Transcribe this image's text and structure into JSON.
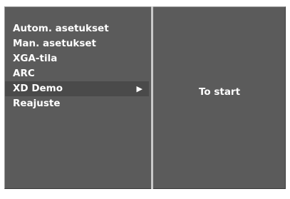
{
  "menu": {
    "items": [
      {
        "label": "Autom. asetukset"
      },
      {
        "label": "Man. asetukset"
      },
      {
        "label": "XGA-tila"
      },
      {
        "label": "ARC"
      },
      {
        "label": "XD Demo",
        "arrow": "▶"
      },
      {
        "label": "Reajuste"
      }
    ],
    "selected_index": 4
  },
  "submenu": {
    "text": "To start"
  },
  "colors": {
    "panel": "#5b5b5b",
    "selected_row": "#4a4a4a",
    "divider": "#c9c9c9",
    "text": "#ffffff"
  },
  "icons": {
    "submenu_arrow": "right-triangle-icon"
  }
}
